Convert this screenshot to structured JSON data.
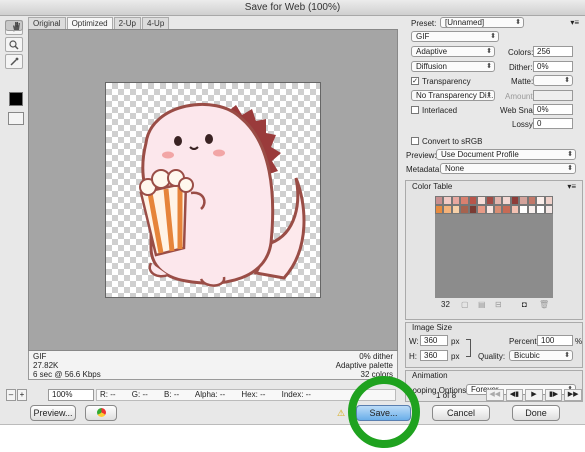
{
  "window": {
    "title": "Save for Web (100%)"
  },
  "tools": [
    "hand-tool",
    "slice-select-tool",
    "zoom-tool",
    "eyedropper-tool"
  ],
  "tabs": [
    "Original",
    "Optimized",
    "2-Up",
    "4-Up"
  ],
  "info": {
    "format": "GIF",
    "size": "27.82K",
    "speed": "6 sec @ 56.6 Kbps",
    "dither": "0% dither",
    "palette": "Adaptive palette",
    "colors": "32 colors"
  },
  "status": {
    "zoom": "100%",
    "r": "R: --",
    "g": "G: --",
    "b": "B: --",
    "alpha": "Alpha: --",
    "hex": "Hex: --",
    "index": "Index: --"
  },
  "buttons": {
    "preview": "Preview...",
    "save": "Save...",
    "cancel": "Cancel",
    "done": "Done"
  },
  "settings": {
    "preset_label": "Preset:",
    "preset_value": "[Unnamed]",
    "format": "GIF",
    "reduction": "Adaptive",
    "colors_label": "Colors:",
    "colors_value": "256",
    "dither_algo": "Diffusion",
    "dither_label": "Dither:",
    "dither_value": "0%",
    "transparency": "Transparency",
    "matte_label": "Matte:",
    "transparency_dither": "No Transparency Di...",
    "amount_label": "Amount:",
    "interlaced": "Interlaced",
    "websnap_label": "Web Snap:",
    "websnap_value": "0%",
    "lossy_label": "Lossy:",
    "lossy_value": "0",
    "convert_srgb": "Convert to sRGB",
    "preview_label": "Preview:",
    "preview_value": "Use Document Profile",
    "metadata_label": "Metadata:",
    "metadata_value": "None"
  },
  "color_table": {
    "title": "Color Table",
    "count": "32",
    "swatches": [
      "#c98f8f",
      "#f0c9c4",
      "#e8a8a0",
      "#d9806f",
      "#b8554a",
      "#f6ded8",
      "#a24c45",
      "#e3b6ae",
      "#f2d7d2",
      "#8e3d39",
      "#d4a39b",
      "#c27869",
      "#fbeeea",
      "#efd0c9",
      "#e68a3f",
      "#f4b27a",
      "#f7d0a8",
      "#a6634f",
      "#7a3b33",
      "#e79a86",
      "#f9e4de",
      "#d88d73",
      "#c76a55",
      "#f3c1b2",
      "#ffffff",
      "#f8f0ee",
      "#ffffff",
      "#f2e6e4"
    ]
  },
  "image_size": {
    "title": "Image Size",
    "w_label": "W:",
    "w_value": "360",
    "h_label": "H:",
    "h_value": "360",
    "unit": "px",
    "percent_label": "Percent:",
    "percent_value": "100",
    "percent_unit": "%",
    "quality_label": "Quality:",
    "quality_value": "Bicubic"
  },
  "animation": {
    "title": "Animation",
    "looping_label": "Looping Options:",
    "looping_value": "Forever",
    "frame": "1 of 8"
  },
  "colors": {
    "highlight": "#1fa21f"
  }
}
